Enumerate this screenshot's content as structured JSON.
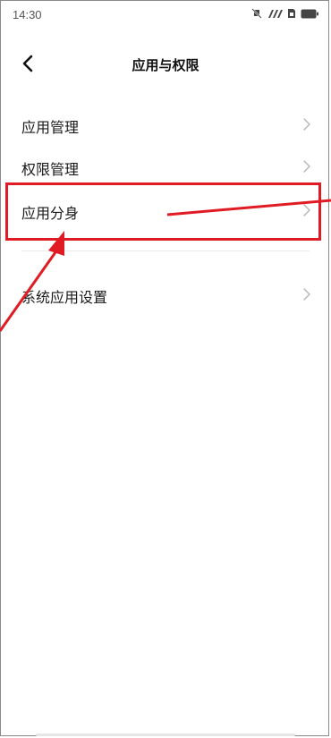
{
  "status_bar": {
    "time": "14:30",
    "icons": [
      "silent-icon",
      "signal-icon",
      "sim-icon",
      "battery-icon"
    ]
  },
  "header": {
    "back_icon": "chevron-left-icon",
    "title": "应用与权限"
  },
  "menu": {
    "items": [
      {
        "label": "应用管理",
        "icon": "chevron-right-icon"
      },
      {
        "label": "权限管理",
        "icon": "chevron-right-icon"
      },
      {
        "label": "应用分身",
        "icon": "chevron-right-icon"
      },
      {
        "label": "系统应用设置",
        "icon": "chevron-right-icon"
      }
    ]
  },
  "annotation": {
    "color": "#e01b24",
    "highlighted_item": "应用分身"
  }
}
